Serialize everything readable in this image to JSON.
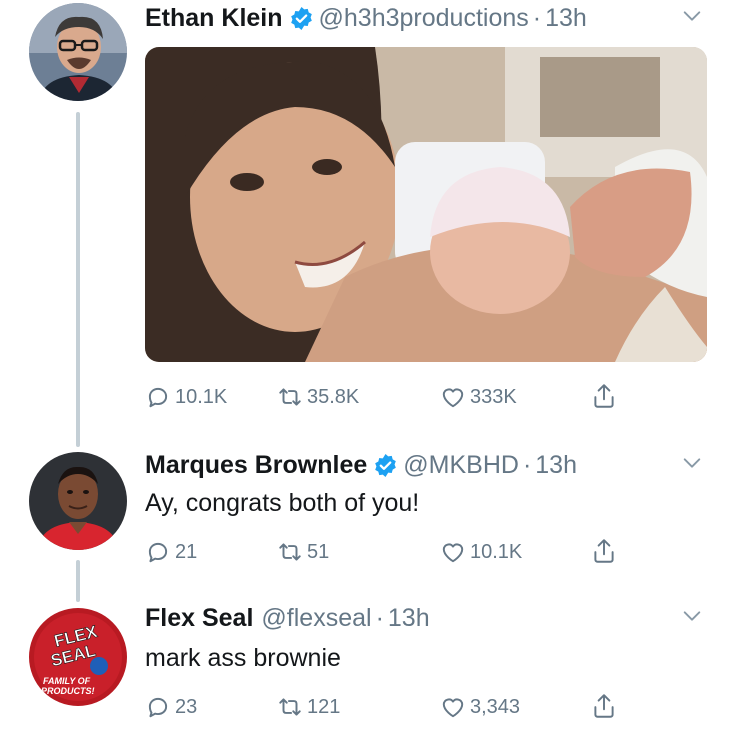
{
  "tweets": [
    {
      "name": "Ethan Klein",
      "verified": true,
      "handle": "@h3h3productions",
      "separator": "·",
      "time": "13h",
      "text": "",
      "replies": "10.1K",
      "retweets": "35.8K",
      "likes": "333K"
    },
    {
      "name": "Marques Brownlee",
      "verified": true,
      "handle": "@MKBHD",
      "separator": "·",
      "time": "13h",
      "text": "Ay, congrats both of you!",
      "replies": "21",
      "retweets": "51",
      "likes": "10.1K"
    },
    {
      "name": "Flex Seal",
      "verified": false,
      "handle": "@flexseal",
      "separator": "·",
      "time": "13h",
      "text": "mark ass brownie",
      "replies": "23",
      "retweets": "121",
      "likes": "3,343"
    }
  ],
  "flex_seal_logo": {
    "line1": "FLEX",
    "line2": "SEAL",
    "line3": "FAMILY OF",
    "line4": "PRODUCTS!"
  },
  "colors": {
    "verified": "#1da1f2",
    "muted": "#657786",
    "thread_line": "#c4cfd6",
    "text": "#14171a"
  },
  "icons": [
    "reply-icon",
    "retweet-icon",
    "like-icon",
    "share-icon",
    "chevron-down-icon",
    "verified-badge-icon"
  ]
}
